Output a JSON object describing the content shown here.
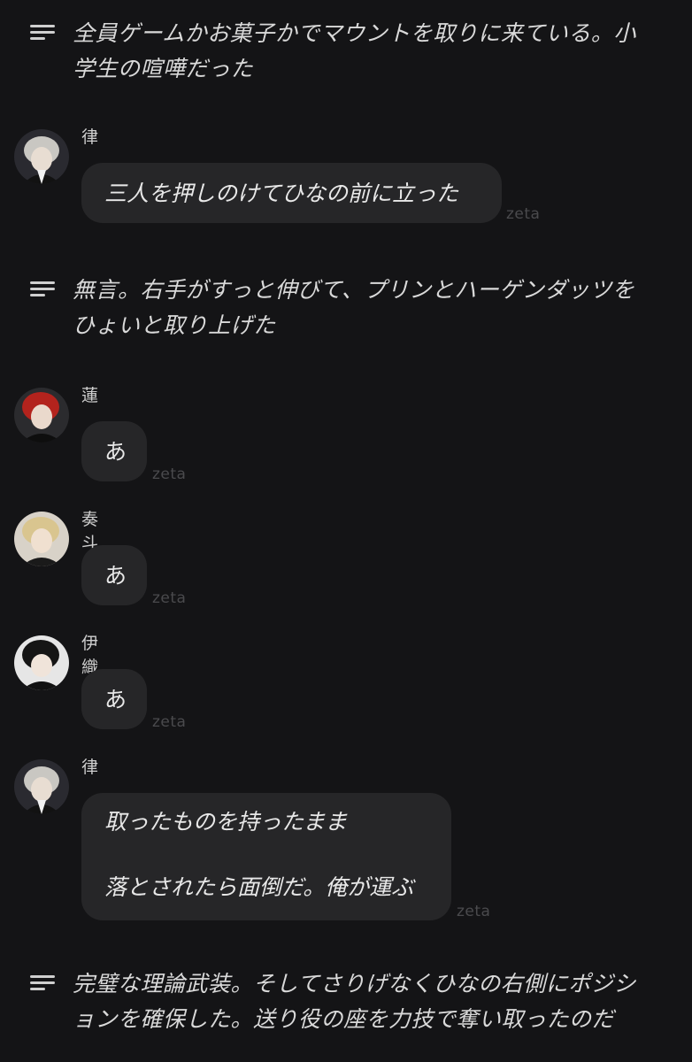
{
  "narrations": [
    "全員ゲームかお菓子かでマウントを取りに来ている。小学生の喧嘩だった",
    "無言。右手がすっと伸びて、プリンとハーゲンダッツをひょいと取り上げた",
    "完璧な理論武装。そしてさりげなくひなの右側にポジションを確保した。送り役の座を力技で奪い取ったのだ"
  ],
  "narration_lines": {
    "n1": [
      "全員ゲームかお菓子かでマウントを取りに来ている。小",
      "学生の喧嘩だった"
    ],
    "n2": [
      "無言。右手がすっと伸びて、プリンとハーゲンダッツを",
      "ひょいと取り上げた"
    ],
    "n3": [
      "完璧な理論武装。そしてさりげなくひなの右側にポジシ",
      "ョンを確保した。送り役の座を力技で奪い取ったのだ"
    ]
  },
  "messages": [
    {
      "name": "律",
      "lines": [
        "三人を押しのけてひなの前に立った"
      ],
      "brand": "zeta",
      "avatar": "silver-hair-avatar"
    },
    {
      "name": "蓮",
      "lines": [
        "あ"
      ],
      "brand": "zeta",
      "avatar": "red-hair-avatar"
    },
    {
      "name": "奏斗",
      "lines": [
        "あ"
      ],
      "brand": "zeta",
      "avatar": "blonde-hair-avatar"
    },
    {
      "name": "伊織",
      "lines": [
        "あ"
      ],
      "brand": "zeta",
      "avatar": "black-hair-avatar"
    },
    {
      "name": "律",
      "lines": [
        "取ったものを持ったまま",
        "落とされたら面倒だ。俺が運ぶ"
      ],
      "brand": "zeta",
      "avatar": "silver-hair-avatar"
    }
  ],
  "colors": {
    "background": "#141416",
    "bubble": "#262628",
    "text": "#e6e6e6",
    "brand": "#4a4a4d"
  }
}
